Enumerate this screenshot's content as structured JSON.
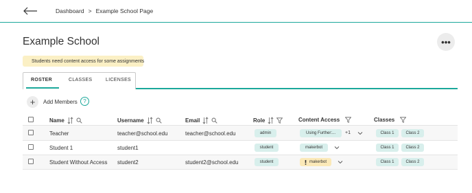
{
  "breadcrumb": {
    "root": "Dashboard",
    "separator": ">",
    "current": "Example School Page"
  },
  "page": {
    "title": "Example School",
    "more_label": "•••"
  },
  "notice": {
    "text": "Students need content access for some assignments",
    "icon": "exclamation-icon",
    "color": "#fbf0c5"
  },
  "tabs": [
    {
      "label": "ROSTER",
      "active": true
    },
    {
      "label": "CLASSES",
      "active": false
    },
    {
      "label": "LICENSES",
      "active": false
    }
  ],
  "add_members": {
    "label": "Add Members",
    "help": "?"
  },
  "columns": {
    "name": "Name",
    "username": "Username",
    "email": "Email",
    "role": "Role",
    "content_access": "Content Access",
    "classes": "Classes"
  },
  "rows": [
    {
      "name": "Teacher",
      "username": "teacher@school.edu",
      "email": "teacher@school.edu",
      "role": "admin",
      "access": "Using Further:...",
      "access_extra": "+1",
      "classes": [
        "Class 1",
        "Class 2"
      ]
    },
    {
      "name": "Student 1",
      "username": "student1",
      "email": "",
      "role": "student",
      "access": "makerbot",
      "classes": [
        "Class 1",
        "Class 2"
      ]
    },
    {
      "name": "Student Without Access",
      "username": "student2",
      "email": "student2@school.edu",
      "role": "student",
      "access": "makerbot",
      "access_warning": true,
      "classes": [
        "Class 1",
        "Class 2"
      ]
    }
  ],
  "colors": {
    "accent": "#1aa89a",
    "chip": "#d8efec",
    "warning": "#fbe9b8"
  }
}
